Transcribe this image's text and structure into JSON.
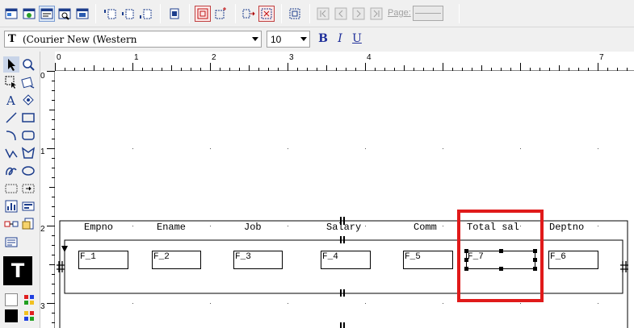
{
  "toolbar": {
    "buttons_row1": [
      {
        "name": "report-editor-icon"
      },
      {
        "name": "data-model-icon"
      },
      {
        "name": "layout-model-icon"
      },
      {
        "name": "parameter-form-icon"
      },
      {
        "name": "live-previewer-icon"
      },
      {
        "name": "header-section-icon"
      },
      {
        "name": "main-section-icon"
      },
      {
        "name": "trailer-section-icon"
      },
      {
        "name": "confine-icon"
      },
      {
        "name": "frame-select-icon"
      },
      {
        "name": "flex-mode-icon"
      },
      {
        "name": "align-objects-icon"
      },
      {
        "name": "size-objects-icon"
      },
      {
        "name": "group-icon"
      },
      {
        "name": "first-page-icon"
      },
      {
        "name": "previous-page-icon"
      },
      {
        "name": "next-page-icon"
      },
      {
        "name": "last-page-icon"
      }
    ],
    "page_label": "Page:",
    "page_value": ""
  },
  "format_bar": {
    "font_name": "(Courier New (Western",
    "font_size": "10",
    "bold_label": "B",
    "italic_label": "I",
    "underline_label": "U"
  },
  "palette": {
    "tools": [
      "select-arrow-icon",
      "magnify-icon",
      "frame-select-icon",
      "rotate-icon",
      "text-tool-icon",
      "reshape-icon",
      "line-tool-icon",
      "rectangle-tool-icon",
      "arc-tool-icon",
      "rounded-rectangle-tool-icon",
      "polyline-tool-icon",
      "polygon-tool-icon",
      "freehand-tool-icon",
      "ellipse-tool-icon",
      "frame-tool-icon",
      "repeating-frame-tool-icon",
      "chart-tool-icon",
      "field-tool-icon",
      "link-tool-icon",
      "file-link-tool-icon",
      "button-tool-icon"
    ],
    "current_tool_label": "T"
  },
  "rulers": {
    "h_numbers": [
      "0",
      "1",
      "2",
      "3",
      "4",
      "7"
    ],
    "v_numbers": [
      "0",
      "1",
      "2",
      "3"
    ]
  },
  "report": {
    "columns": [
      {
        "header": "Empno",
        "field": "F_1"
      },
      {
        "header": "Ename",
        "field": "F_2"
      },
      {
        "header": "Job",
        "field": "F_3"
      },
      {
        "header": "Salary",
        "field": "F_4"
      },
      {
        "header": "Comm",
        "field": "F_5"
      },
      {
        "header": "Total sal",
        "field": "F_7"
      },
      {
        "header": "Deptno",
        "field": "F_6"
      }
    ],
    "highlight_color": "#e01a1a"
  }
}
